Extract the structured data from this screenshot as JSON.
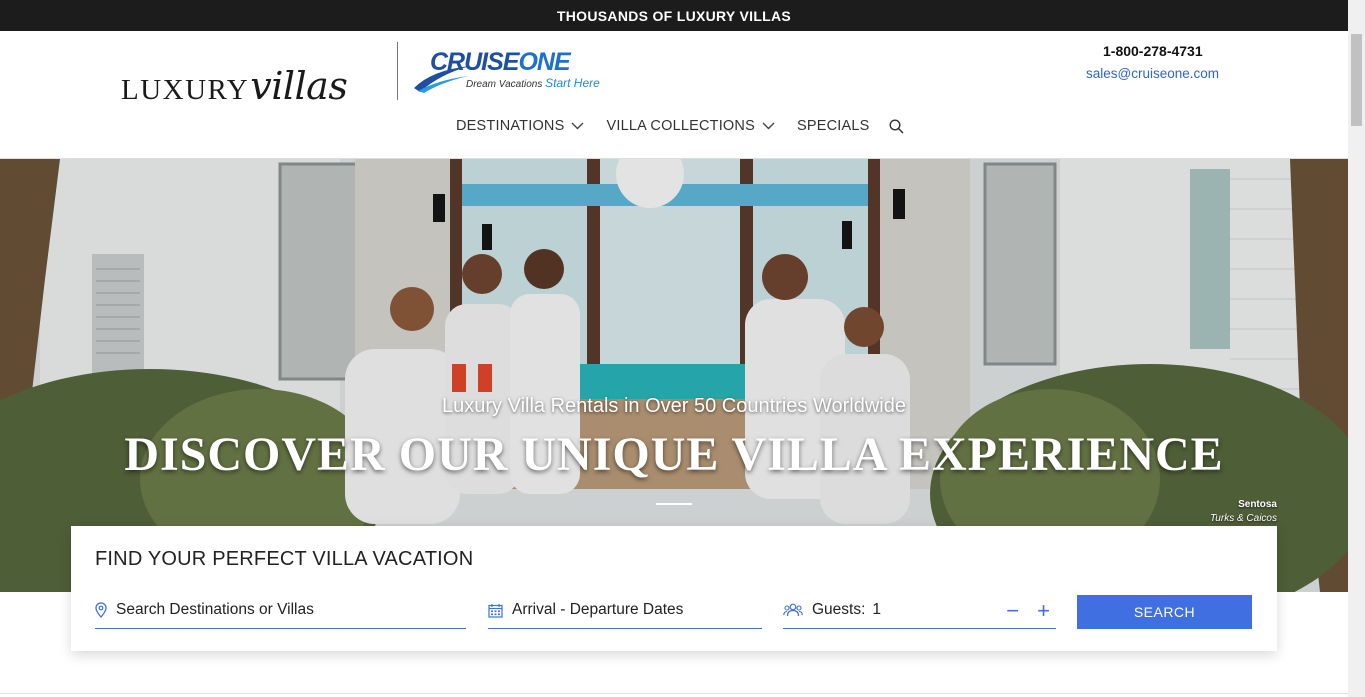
{
  "topbar": {
    "text": "THOUSANDS OF LUXURY VILLAS"
  },
  "brand": {
    "luxury_caps": "LUXURY",
    "luxury_script": "villas",
    "cruise_name_a": "CRUISE",
    "cruise_name_b": "ONE",
    "cruise_tagline": "Dream Vacations",
    "cruise_tagline_script": "Start Here"
  },
  "contact": {
    "phone": "1-800-278-4731",
    "email": "sales@cruiseone.com"
  },
  "nav": {
    "items": [
      {
        "label": "DESTINATIONS"
      },
      {
        "label": "VILLA COLLECTIONS"
      },
      {
        "label": "SPECIALS"
      }
    ]
  },
  "hero": {
    "subtitle": "Luxury Villa Rentals in Over 50 Countries Worldwide",
    "title": "DISCOVER OUR UNIQUE VILLA EXPERIENCE",
    "caption_name": "Sentosa",
    "caption_location": "Turks & Caicos"
  },
  "search": {
    "title": "FIND YOUR PERFECT VILLA VACATION",
    "destination_placeholder": "Search Destinations or Villas",
    "dates_placeholder": "Arrival - Departure Dates",
    "guests_label": "Guests:",
    "guests_value": "1",
    "decrement": "−",
    "increment": "+",
    "button_label": "SEARCH"
  },
  "colors": {
    "accent": "#3f6fe0",
    "topbar": "#1c1c1c",
    "brand_blue": "#1d4fa3"
  }
}
